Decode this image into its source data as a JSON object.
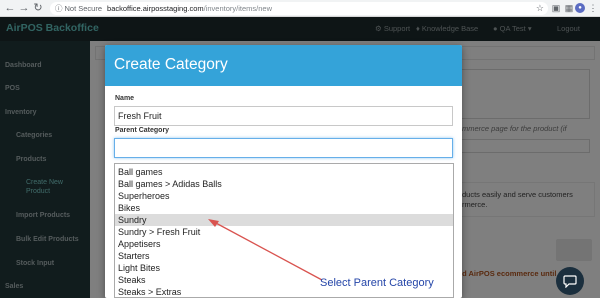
{
  "browser": {
    "back_icon": "back-arrow-icon",
    "forward_icon": "forward-arrow-icon",
    "reload_icon": "reload-icon",
    "security_label": "Not Secure",
    "url_domain": "backoffice.airposstaging.com",
    "url_path": "/inventory/items/new"
  },
  "header": {
    "brand": "AirPOS Backoffice",
    "support": "Support",
    "knowledge_base": "Knowledge Base",
    "user": "QA Test",
    "logout": "Logout"
  },
  "sidebar": {
    "items": [
      {
        "label": "Dashboard"
      },
      {
        "label": "POS"
      },
      {
        "label": "Inventory"
      },
      {
        "label": "Categories"
      },
      {
        "label": "Products"
      },
      {
        "label": "Create New Product"
      },
      {
        "label": "Import Products"
      },
      {
        "label": "Bulk Edit Products"
      },
      {
        "label": "Stock Input"
      },
      {
        "label": "Sales"
      }
    ]
  },
  "background": {
    "ecommerce_hint": "mmerce page for the product (if",
    "products_line1": "ducts easily and serve customers",
    "products_line2": "rmerce.",
    "warning": "ld AirPOS ecommerce until"
  },
  "modal": {
    "title": "Create Category",
    "name_label": "Name",
    "name_value": "Fresh Fruit",
    "parent_label": "Parent Category",
    "parent_value": ""
  },
  "dropdown": {
    "options": [
      "Ball games",
      "Ball games > Adidas Balls",
      "Superheroes",
      "Bikes",
      "Sundry",
      "Sundry > Fresh Fruit",
      "Appetisers",
      "Starters",
      "Light Bites",
      "Steaks",
      "Steaks > Extras"
    ],
    "highlighted": "Sundry"
  },
  "annotation": {
    "text": "Select Parent Category",
    "color": "#d9534f"
  },
  "colors": {
    "header_bg": "#1d2b2d",
    "sidebar_bg": "#23393b",
    "modal_header": "#34a3d9",
    "brand": "#63c8c4"
  }
}
